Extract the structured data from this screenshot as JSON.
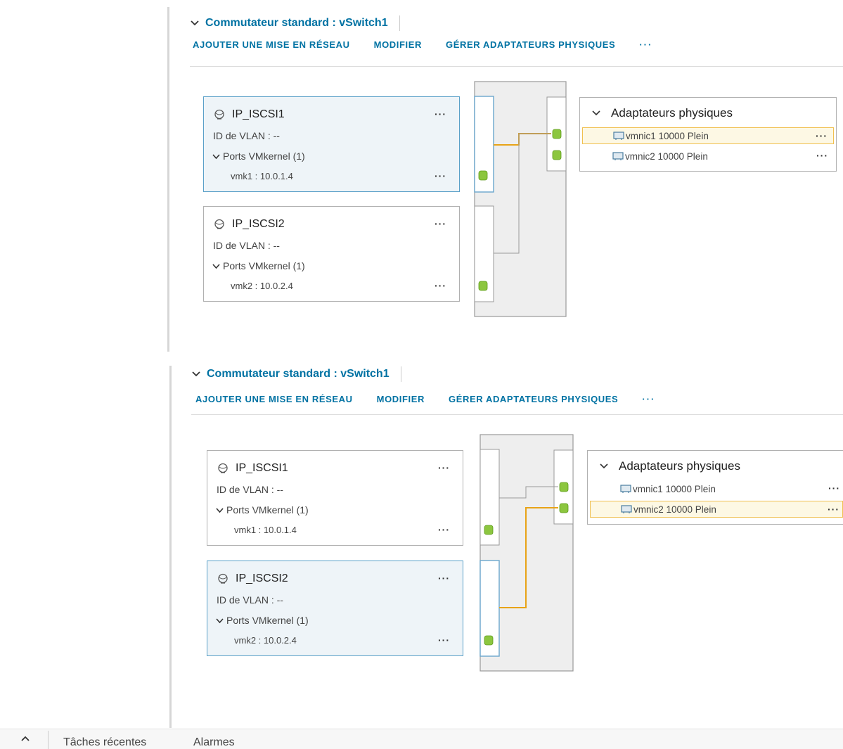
{
  "top_view": {
    "title": "Commutateur standard : vSwitch1",
    "actions": [
      "AJOUTER UNE MISE EN RÉSEAU",
      "MODIFIER",
      "GÉRER ADAPTATEURS PHYSIQUES"
    ],
    "more_label": "···",
    "port_groups": [
      {
        "name": "IP_ISCSI1",
        "vlan": "ID de VLAN : --",
        "ports_label": "Ports VMkernel (1)",
        "vmk": "vmk1 : 10.0.1.4",
        "selected": true
      },
      {
        "name": "IP_ISCSI2",
        "vlan": "ID de VLAN : --",
        "ports_label": "Ports VMkernel (1)",
        "vmk": "vmk2 : 10.0.2.4",
        "selected": false
      }
    ],
    "adapters_title": "Adaptateurs physiques",
    "adapters": [
      {
        "label": "vmnic1 10000 Plein",
        "selected": true
      },
      {
        "label": "vmnic2 10000 Plein",
        "selected": false
      }
    ]
  },
  "bottom_view": {
    "title": "Commutateur standard : vSwitch1",
    "actions": [
      "AJOUTER UNE MISE EN RÉSEAU",
      "MODIFIER",
      "GÉRER ADAPTATEURS PHYSIQUES"
    ],
    "more_label": "···",
    "port_groups": [
      {
        "name": "IP_ISCSI1",
        "vlan": "ID de VLAN : --",
        "ports_label": "Ports VMkernel (1)",
        "vmk": "vmk1 : 10.0.1.4",
        "selected": false
      },
      {
        "name": "IP_ISCSI2",
        "vlan": "ID de VLAN : --",
        "ports_label": "Ports VMkernel (1)",
        "vmk": "vmk2 : 10.0.2.4",
        "selected": true
      }
    ],
    "adapters_title": "Adaptateurs physiques",
    "adapters": [
      {
        "label": "vmnic1 10000 Plein",
        "selected": false
      },
      {
        "label": "vmnic2 10000 Plein",
        "selected": true
      }
    ]
  },
  "bottom_bar": {
    "tabs": [
      "Tâches récentes",
      "Alarmes"
    ]
  },
  "colors": {
    "link": "#0072a3",
    "selected_border": "#5aa0c8",
    "selected_fill": "#eef4f8",
    "active_path": "#e8a317",
    "port_green": "#8cc63f",
    "adapter_highlight": "#f0c050"
  }
}
